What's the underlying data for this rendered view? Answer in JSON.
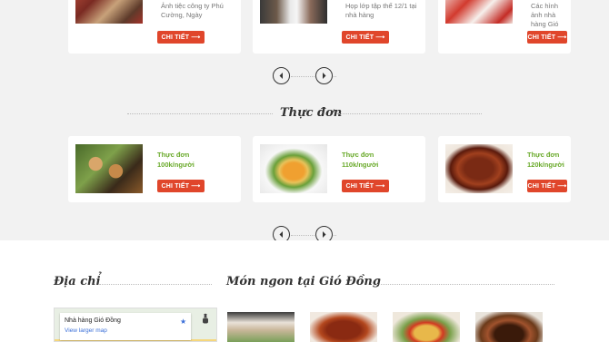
{
  "events": {
    "cards": [
      {
        "text": "Ảnh tiệc công ty Phú Cường, Ngày",
        "button": "CHI TIẾT"
      },
      {
        "text": "Họp lớp tập thể 12/1 tại nhà hàng",
        "button": "CHI TIẾT"
      },
      {
        "text": "Các hình ảnh nhà hàng Gió",
        "button": "CHI TIẾT"
      }
    ]
  },
  "menu": {
    "title": "Thực đơn",
    "cards": [
      {
        "title_line1": "Thực đơn",
        "title_line2": "100k/người",
        "button": "CHI TIẾT"
      },
      {
        "title_line1": "Thực đơn",
        "title_line2": "110k/người",
        "button": "CHI TIẾT"
      },
      {
        "title_line1": "Thực đơn",
        "title_line2": "120k/người",
        "button": "CHI TIẾT"
      }
    ]
  },
  "address": {
    "title": "Địa chỉ",
    "map_place": "Nhà hàng Gió Đồng",
    "map_link": "View larger map"
  },
  "dishes": {
    "title": "Món ngon tại Gió Đồng"
  },
  "colors": {
    "accent": "#e0462b",
    "menu_green": "#6aaa2b",
    "background": "#f2f2f2"
  }
}
